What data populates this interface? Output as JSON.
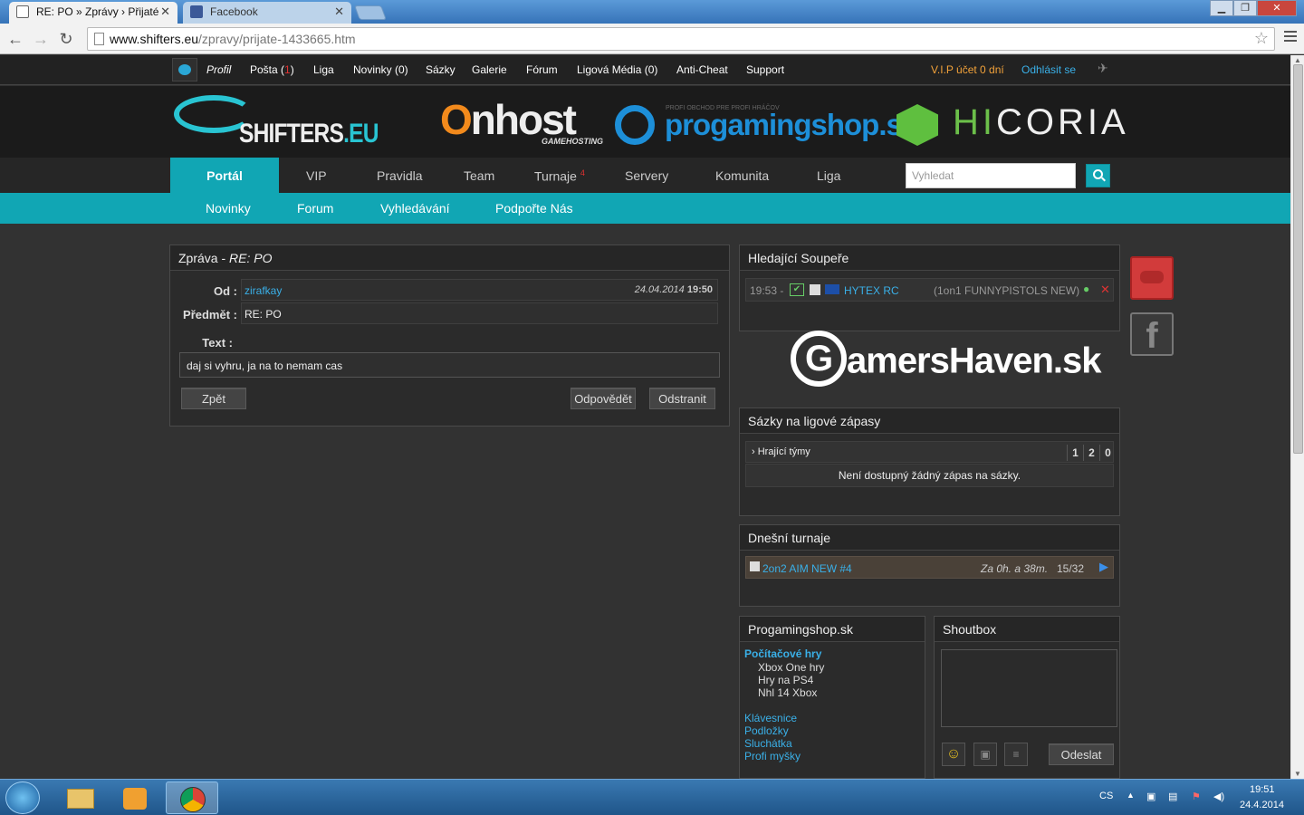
{
  "browser": {
    "tabs": [
      {
        "title": "RE: PO » Zprávy › Přijaté",
        "active": true
      },
      {
        "title": "Facebook",
        "active": false
      }
    ],
    "url_host": "www.shifters.eu",
    "url_path": "/zpravy/prijate-1433665.htm"
  },
  "topbar": {
    "profile": "Profil",
    "mail_label": "Pošta (",
    "mail_count": "1",
    "mail_close": ")",
    "items": [
      "Liga",
      "Novinky (0)",
      "Sázky",
      "Galerie",
      "Fórum",
      "Ligová Média (0)",
      "Anti-Cheat",
      "Support"
    ],
    "vip": "V.I.P účet 0 dní",
    "logout": "Odhlásit se"
  },
  "banner": {
    "shifters": "SHIFTERS",
    "shifters_tld": ".EU",
    "onhost_o": "O",
    "onhost_rest": "nhost",
    "onhost_sub": "GAMEHOSTING",
    "pgs_tag": "PROFI OBCHOD PRE PROFI HRÁČOV",
    "pgs": "progamingshop.sk",
    "hicoria_hi": "HI",
    "hicoria_rest": "CORIA"
  },
  "mainnav": {
    "items": [
      "Portál",
      "VIP",
      "Pravidla",
      "Team",
      "Turnaje",
      "Servery",
      "Komunita",
      "Liga"
    ],
    "turnaje_badge": "4",
    "search_placeholder": "Vyhledat"
  },
  "subnav": [
    "Novinky",
    "Forum",
    "Vyhledávání",
    "Podpořte Nás"
  ],
  "message": {
    "header_prefix": "Zpráva - ",
    "header_subject": "RE: PO",
    "from_label": "Od :",
    "from_value": "zirafkay",
    "date": "24.04.2014",
    "time": "19:50",
    "subject_label": "Předmět :",
    "subject_value": "RE: PO",
    "text_label": "Text :",
    "text_value": "daj si vyhru, ja na to nemam cas",
    "back_button": "Zpět",
    "reply_button": "Odpovědět",
    "delete_button": "Odstranit"
  },
  "opponents": {
    "title": "Hledající Soupeře",
    "time": "19:53 -",
    "team": "HYTEX RC",
    "mode": "(1on1 FUNNYPISTOLS NEW)"
  },
  "gamershaven": {
    "logo_g": "G",
    "logo_rest": "amersHaven.sk"
  },
  "bets": {
    "title": "Sázky na ligové zápasy",
    "col_label": "› Hrající týmy",
    "col_1": "1",
    "col_2": "2",
    "col_0": "0",
    "empty": "Není dostupný žádný zápas na sázky."
  },
  "tournaments": {
    "title": "Dnešní turnaje",
    "name": "2on2 AIM NEW #4",
    "starts": "Za 0h. a 38m.",
    "slots": "15/32"
  },
  "shop": {
    "title": "Progamingshop.sk",
    "category": "Počítačové hry",
    "games": [
      "Xbox One hry",
      "Hry na PS4",
      "Nhl 14 Xbox"
    ],
    "links": [
      "Klávesnice",
      "Podložky",
      "Sluchátka",
      "Profi myšky"
    ]
  },
  "shoutbox": {
    "title": "Shoutbox",
    "send_button": "Odeslat"
  },
  "taskbar": {
    "lang": "CS",
    "time": "19:51",
    "date": "24.4.2014"
  },
  "colors": {
    "accent": "#11a6b4",
    "link": "#3ab0e8",
    "alert": "#e03030"
  }
}
